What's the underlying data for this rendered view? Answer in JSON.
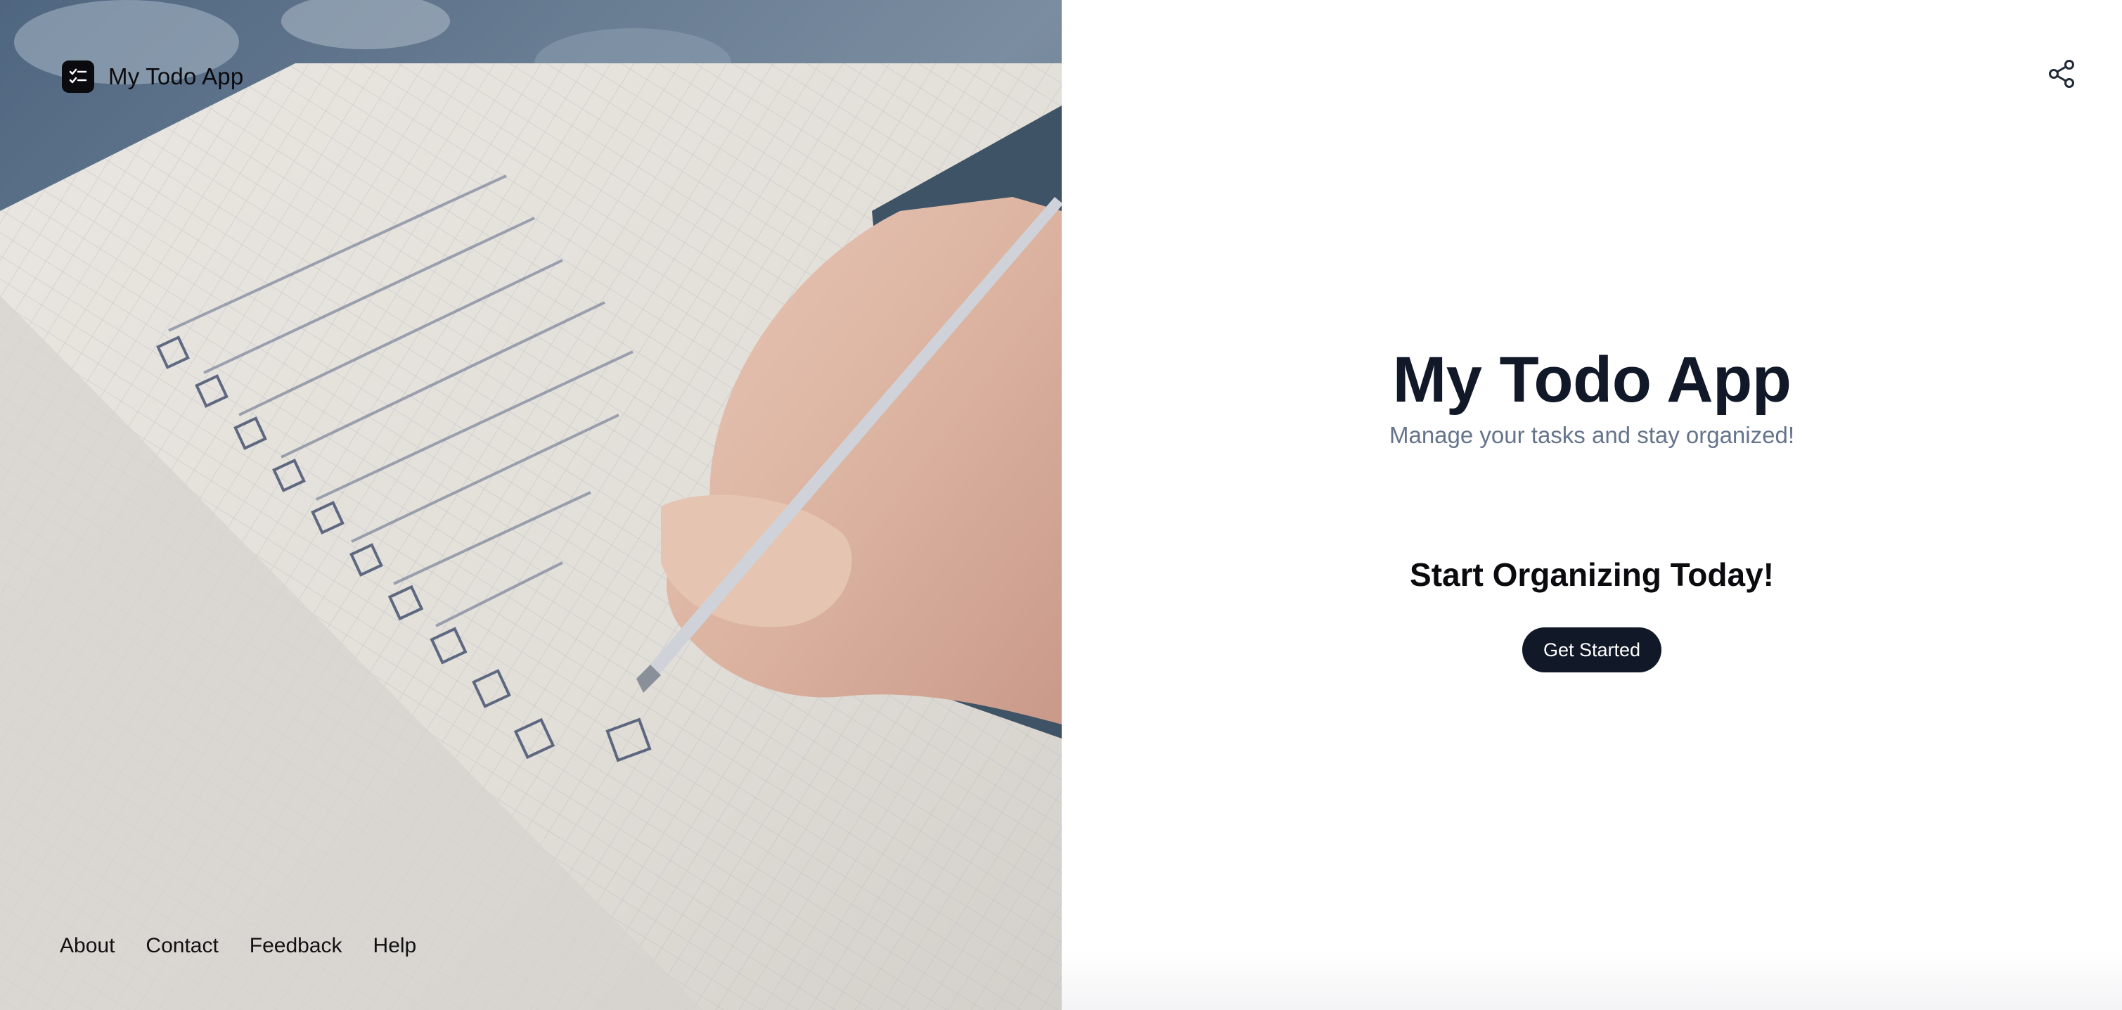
{
  "header": {
    "app_name": "My Todo App",
    "logo_icon": "checklist-icon",
    "share_icon": "share-icon"
  },
  "hero": {
    "title": "My Todo App",
    "subtitle": "Manage your tasks and stay organized!"
  },
  "cta": {
    "heading": "Start Organizing Today!",
    "button_label": "Get Started"
  },
  "footer": {
    "links": [
      "About",
      "Contact",
      "Feedback",
      "Help"
    ]
  },
  "colors": {
    "primary": "#111827",
    "subtitle": "#64748b",
    "button_text": "#ffffff"
  }
}
